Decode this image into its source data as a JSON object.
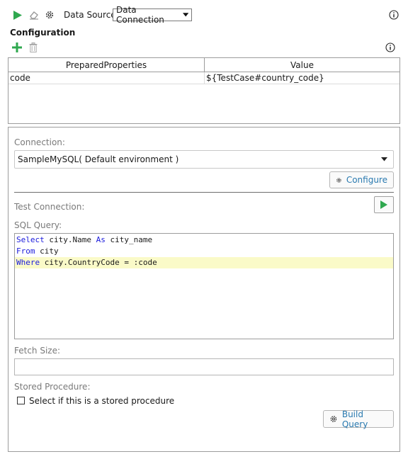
{
  "toolbar": {
    "data_source_label": "Data Source:",
    "data_source_value": "Data Connection"
  },
  "configuration": {
    "title": "Configuration",
    "table": {
      "headers": [
        "PreparedProperties",
        "Value"
      ],
      "rows": [
        {
          "property": "code",
          "value": "${TestCase#country_code}"
        }
      ]
    }
  },
  "connection": {
    "label": "Connection:",
    "value": "SampleMySQL( Default environment )",
    "configure_label": "Configure"
  },
  "test_connection": {
    "label": "Test Connection:"
  },
  "sql": {
    "label": "SQL Query:",
    "lines": [
      {
        "kw": "Select",
        "rest": " city.Name ",
        "kw2": "As",
        "rest2": " city_name"
      },
      {
        "kw": "From",
        "rest": " city",
        "kw2": "",
        "rest2": ""
      },
      {
        "kw": "Where",
        "rest": " city.CountryCode = :code",
        "kw2": "",
        "rest2": ""
      }
    ]
  },
  "fetch_size": {
    "label": "Fetch Size:",
    "value": ""
  },
  "stored_procedure": {
    "label": "Stored Procedure:",
    "checkbox_label": "Select if this is a stored procedure",
    "checked": false
  },
  "build_query_label": "Build Query",
  "colors": {
    "run_green": "#2fa84f",
    "link_blue": "#2a7ab0",
    "keyword_blue": "#1a1adc",
    "highlight": "#fafac8"
  }
}
